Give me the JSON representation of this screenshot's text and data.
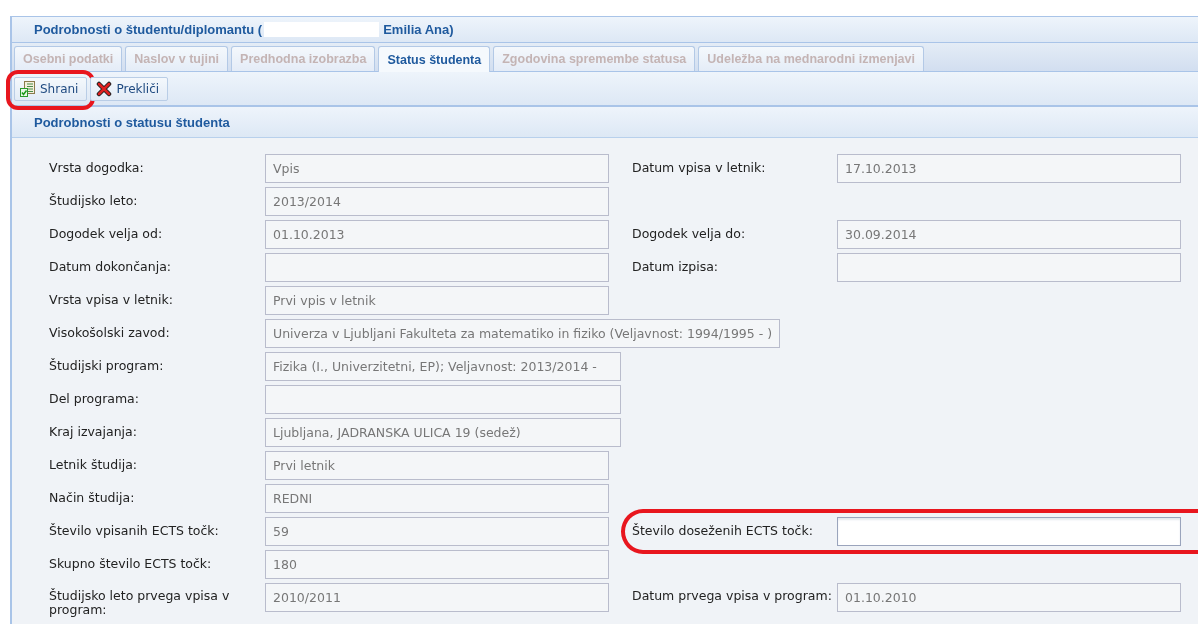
{
  "panel": {
    "title_start": "Podrobnosti o študentu/diplomantu (",
    "title_redacted": true,
    "title_end": "Emilia Ana)"
  },
  "tabs": [
    {
      "label": "Osebni podatki",
      "selected": false
    },
    {
      "label": "Naslov v tujini",
      "selected": false
    },
    {
      "label": "Predhodna izobrazba",
      "selected": false
    },
    {
      "label": "Status študenta",
      "selected": true
    },
    {
      "label": "Zgodovina spremembe statusa",
      "selected": false
    },
    {
      "label": "Udeležba na mednarodni izmenjavi",
      "selected": false
    }
  ],
  "toolbar": [
    {
      "kind": "save",
      "label": "Shrani",
      "highlighted": true
    },
    {
      "kind": "cancel",
      "label": "Prekliči",
      "highlighted": false
    }
  ],
  "section": {
    "title": "Podrobnosti o statusu študenta"
  },
  "rows": [
    {
      "kind": "double",
      "fields": [
        {
          "label": "Vrsta dogodka:",
          "value": "Vpis",
          "editable": false,
          "highlighted": false
        },
        {
          "label": "Datum vpisa v letnik:",
          "value": "17.10.2013",
          "editable": false,
          "highlighted": false
        }
      ]
    },
    {
      "kind": "single",
      "fields": [
        {
          "label": "Študijsko leto:",
          "value": "2013/2014",
          "editable": false,
          "highlighted": false
        }
      ]
    },
    {
      "kind": "double",
      "fields": [
        {
          "label": "Dogodek velja od:",
          "value": "01.10.2013",
          "editable": false,
          "highlighted": false
        },
        {
          "label": "Dogodek velja do:",
          "value": "30.09.2014",
          "editable": false,
          "highlighted": false
        }
      ]
    },
    {
      "kind": "double",
      "fields": [
        {
          "label": "Datum dokončanja:",
          "editable": false,
          "highlighted": false
        },
        {
          "label": "Datum izpisa:",
          "editable": false,
          "highlighted": false
        }
      ]
    },
    {
      "kind": "single",
      "fields": [
        {
          "label": "Vrsta vpisa v letnik:",
          "value": "Prvi vpis v letnik",
          "editable": false,
          "highlighted": false
        }
      ]
    },
    {
      "kind": "wide",
      "fields": [
        {
          "label": "Visokošolski zavod:",
          "value": "Univerza v Ljubljani Fakulteta za matematiko in fiziko (Veljavnost: 1994/1995 - )",
          "editable": false,
          "highlighted": false
        }
      ]
    },
    {
      "kind": "wide",
      "fields": [
        {
          "label": "Študijski program:",
          "value": "Fizika (I., Univerzitetni, EP); Veljavnost: 2013/2014 -",
          "editable": false,
          "highlighted": false
        }
      ]
    },
    {
      "kind": "wide",
      "fields": [
        {
          "label": "Del programa:",
          "editable": false,
          "highlighted": false
        }
      ]
    },
    {
      "kind": "wide",
      "fields": [
        {
          "label": "Kraj izvajanja:",
          "value": "Ljubljana, JADRANSKA ULICA 19 (sedež)",
          "editable": false,
          "highlighted": false
        }
      ]
    },
    {
      "kind": "single",
      "fields": [
        {
          "label": "Letnik študija:",
          "value": "Prvi letnik",
          "editable": false,
          "highlighted": false
        }
      ]
    },
    {
      "kind": "single",
      "fields": [
        {
          "label": "Način študija:",
          "value": "REDNI",
          "editable": false,
          "highlighted": false
        }
      ]
    },
    {
      "kind": "double",
      "fields": [
        {
          "label": "Število vpisanih ECTS točk:",
          "value": "59",
          "editable": false,
          "highlighted": false
        },
        {
          "label": "Število doseženih ECTS točk:",
          "editable": true,
          "highlighted": true
        }
      ]
    },
    {
      "kind": "single",
      "fields": [
        {
          "label": "Skupno število ECTS točk:",
          "value": "180",
          "editable": false,
          "highlighted": false
        }
      ]
    },
    {
      "kind": "double",
      "fields": [
        {
          "label": "Študijsko leto prvega vpisa v program:",
          "value": "2010/2011",
          "editable": false,
          "highlighted": false
        },
        {
          "label": "Datum prvega vpisa v program:",
          "value": "01.10.2010",
          "editable": false,
          "highlighted": false
        }
      ]
    }
  ]
}
